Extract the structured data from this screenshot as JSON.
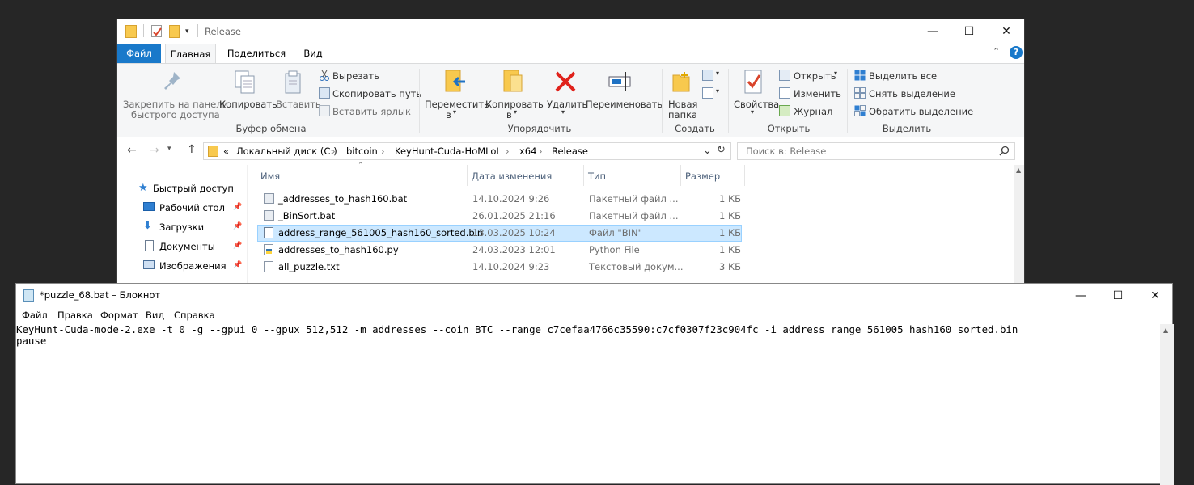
{
  "explorer": {
    "title": "Release",
    "tabs": [
      "Файл",
      "Главная",
      "Поделиться",
      "Вид"
    ],
    "ribbon": {
      "clipboard": {
        "title": "Буфер обмена",
        "pin_line1": "Закрепить на панели",
        "pin_line2": "быстрого доступа",
        "copy": "Копировать",
        "paste": "Вставить",
        "cut": "Вырезать",
        "copy_path": "Скопировать путь",
        "paste_shortcut": "Вставить ярлык"
      },
      "organize": {
        "title": "Упорядочить",
        "move_line1": "Переместить",
        "move_line2": "в",
        "copy_line1": "Копировать",
        "copy_line2": "в",
        "delete": "Удалить",
        "rename": "Переименовать"
      },
      "create": {
        "title": "Создать",
        "new_folder_line1": "Новая",
        "new_folder_line2": "папка"
      },
      "open": {
        "title": "Открыть",
        "properties": "Свойства",
        "open": "Открыть",
        "edit": "Изменить",
        "history": "Журнал"
      },
      "select": {
        "title": "Выделить",
        "select_all": "Выделить все",
        "select_none": "Снять выделение",
        "invert": "Обратить выделение"
      }
    },
    "address": {
      "prefix": "«",
      "crumbs": [
        "Локальный диск (C:)",
        "bitcoin",
        "KeyHunt-Cuda-HoMLoL",
        "x64",
        "Release"
      ],
      "search_placeholder": "Поиск в: Release"
    },
    "nav": {
      "quick_access": "Быстрый доступ",
      "items": [
        "Рабочий стол",
        "Загрузки",
        "Документы",
        "Изображения"
      ]
    },
    "columns": [
      "Имя",
      "Дата изменения",
      "Тип",
      "Размер"
    ],
    "files": [
      {
        "name": "_addresses_to_hash160.bat",
        "date": "14.10.2024 9:26",
        "type": "Пакетный файл ...",
        "size": "1 КБ"
      },
      {
        "name": "_BinSort.bat",
        "date": "26.01.2025 21:16",
        "type": "Пакетный файл ...",
        "size": "1 КБ"
      },
      {
        "name": "address_range_561005_hash160_sorted.bin",
        "date": "13.03.2025 10:24",
        "type": "Файл \"BIN\"",
        "size": "1 КБ"
      },
      {
        "name": "addresses_to_hash160.py",
        "date": "24.03.2023 12:01",
        "type": "Python File",
        "size": "1 КБ"
      },
      {
        "name": "all_puzzle.txt",
        "date": "14.10.2024 9:23",
        "type": "Текстовый докум...",
        "size": "3 КБ"
      }
    ]
  },
  "notepad": {
    "title": "*puzzle_68.bat – Блокнот",
    "menu": [
      "Файл",
      "Правка",
      "Формат",
      "Вид",
      "Справка"
    ],
    "lines": [
      "KeyHunt-Cuda-mode-2.exe -t 0 -g --gpui 0 --gpux 512,512 -m addresses --coin BTC --range c7cefaa4766c35590:c7cf0307f23c904fc -i address_range_561005_hash160_sorted.bin",
      "pause"
    ]
  }
}
